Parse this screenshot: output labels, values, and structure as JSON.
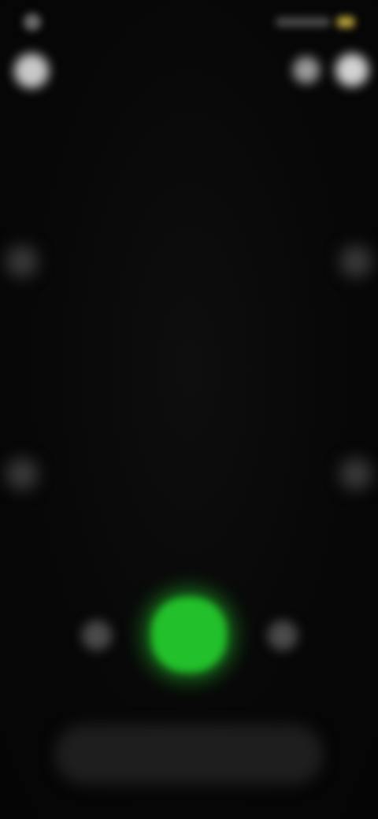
{
  "status_bar": {
    "time": "",
    "signal_icon": "status-icons",
    "battery_icon": "battery-icon"
  },
  "top_controls": {
    "close_icon": "close-icon",
    "flash_icon": "flash-icon",
    "settings_icon": "settings-icon"
  },
  "modes": [
    {
      "label": "",
      "active": true
    },
    {
      "label": "",
      "active": false
    }
  ],
  "shutter": {
    "gallery_icon": "gallery-icon",
    "record_icon": "record-icon",
    "flip_icon": "flip-camera-icon",
    "record_color": "#22c02a"
  },
  "bottom_tabs": [
    {
      "label": "",
      "active": true
    },
    {
      "label": "",
      "active": false
    }
  ],
  "colors": {
    "accent": "#22c02a",
    "mode_active": "#3a6d1e",
    "battery": "#b8a23a",
    "background": "#060606"
  }
}
